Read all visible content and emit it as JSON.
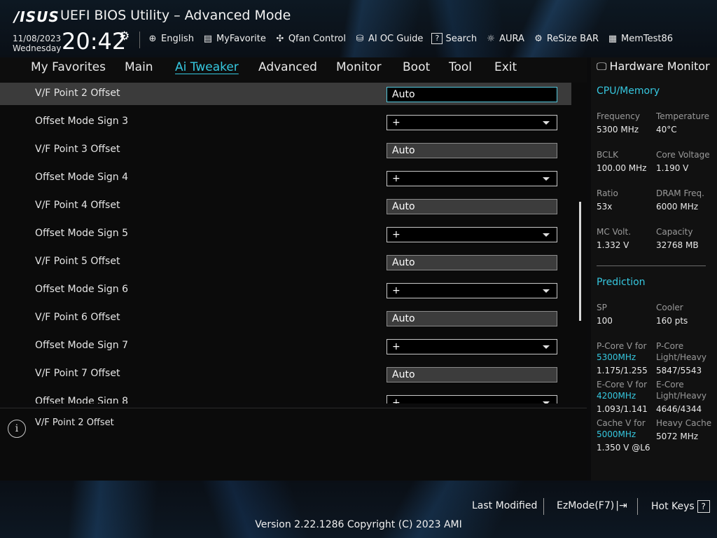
{
  "header": {
    "logo": "/ISUS",
    "title": "UEFI BIOS Utility – Advanced Mode",
    "date": "11/08/2023",
    "day": "Wednesday",
    "time": "20:42",
    "toolbar": [
      {
        "label": "English",
        "icon": "globe-icon"
      },
      {
        "label": "MyFavorite",
        "icon": "favorite-icon"
      },
      {
        "label": "Qfan Control",
        "icon": "fan-icon"
      },
      {
        "label": "AI OC Guide",
        "icon": "ai-chip-icon"
      },
      {
        "label": "Search",
        "icon": "search-help-icon"
      },
      {
        "label": "AURA",
        "icon": "aura-light-icon"
      },
      {
        "label": "ReSize BAR",
        "icon": "resize-bar-icon"
      },
      {
        "label": "MemTest86",
        "icon": "memory-icon"
      }
    ]
  },
  "menu": {
    "items": [
      "My Favorites",
      "Main",
      "Ai Tweaker",
      "Advanced",
      "Monitor",
      "Boot",
      "Tool",
      "Exit"
    ],
    "active": "Ai Tweaker"
  },
  "settings": [
    {
      "label": "V/F Point 2 Offset",
      "value": "Auto",
      "kind": "text",
      "selected": true
    },
    {
      "label": "Offset Mode Sign 3",
      "value": "+",
      "kind": "combo"
    },
    {
      "label": "V/F Point 3 Offset",
      "value": "Auto",
      "kind": "text"
    },
    {
      "label": "Offset Mode Sign 4",
      "value": "+",
      "kind": "combo"
    },
    {
      "label": "V/F Point 4 Offset",
      "value": "Auto",
      "kind": "text"
    },
    {
      "label": "Offset Mode Sign 5",
      "value": "+",
      "kind": "combo"
    },
    {
      "label": "V/F Point 5 Offset",
      "value": "Auto",
      "kind": "text"
    },
    {
      "label": "Offset Mode Sign 6",
      "value": "+",
      "kind": "combo"
    },
    {
      "label": "V/F Point 6 Offset",
      "value": "Auto",
      "kind": "text"
    },
    {
      "label": "Offset Mode Sign 7",
      "value": "+",
      "kind": "combo"
    },
    {
      "label": "V/F Point 7 Offset",
      "value": "Auto",
      "kind": "text"
    },
    {
      "label": "Offset Mode Sign 8",
      "value": "+",
      "kind": "combo"
    }
  ],
  "help": {
    "text": "V/F Point 2 Offset"
  },
  "monitor": {
    "title": "Hardware Monitor",
    "cpu_title": "CPU/Memory",
    "cpu": [
      {
        "label": "Frequency",
        "value": "5300 MHz"
      },
      {
        "label": "Temperature",
        "value": "40°C"
      },
      {
        "label": "BCLK",
        "value": "100.00 MHz"
      },
      {
        "label": "Core Voltage",
        "value": "1.190 V"
      },
      {
        "label": "Ratio",
        "value": "53x"
      },
      {
        "label": "DRAM Freq.",
        "value": "6000 MHz"
      },
      {
        "label": "MC Volt.",
        "value": "1.332 V"
      },
      {
        "label": "Capacity",
        "value": "32768 MB"
      }
    ],
    "pred_title": "Prediction",
    "sp_label": "SP",
    "sp_value": "100",
    "cooler_label": "Cooler",
    "cooler_value": "160 pts",
    "pcore_v_label": "P-Core V for",
    "pcore_v_freq": "5300MHz",
    "pcore_v_value": "1.175/1.255",
    "pcore_lh_label1": "P-Core",
    "pcore_lh_label2": "Light/Heavy",
    "pcore_lh_value": "5847/5543",
    "ecore_v_label": "E-Core V for",
    "ecore_v_freq": "4200MHz",
    "ecore_v_value": "1.093/1.141",
    "ecore_lh_label1": "E-Core",
    "ecore_lh_label2": "Light/Heavy",
    "ecore_lh_value": "4646/4344",
    "cache_v_label": "Cache V for",
    "cache_v_freq": "5000MHz",
    "cache_v_value": "1.350 V @L6",
    "heavy_cache_label": "Heavy Cache",
    "heavy_cache_value": "5072 MHz"
  },
  "footer": {
    "last_modified": "Last Modified",
    "ezmode": "EzMode(F7)",
    "hotkeys": "Hot Keys",
    "hotkeys_key": "?",
    "version": "Version 2.22.1286 Copyright (C) 2023 AMI"
  },
  "colors": {
    "accent": "#36c8e0",
    "selected_row": "#3b3b3b"
  }
}
